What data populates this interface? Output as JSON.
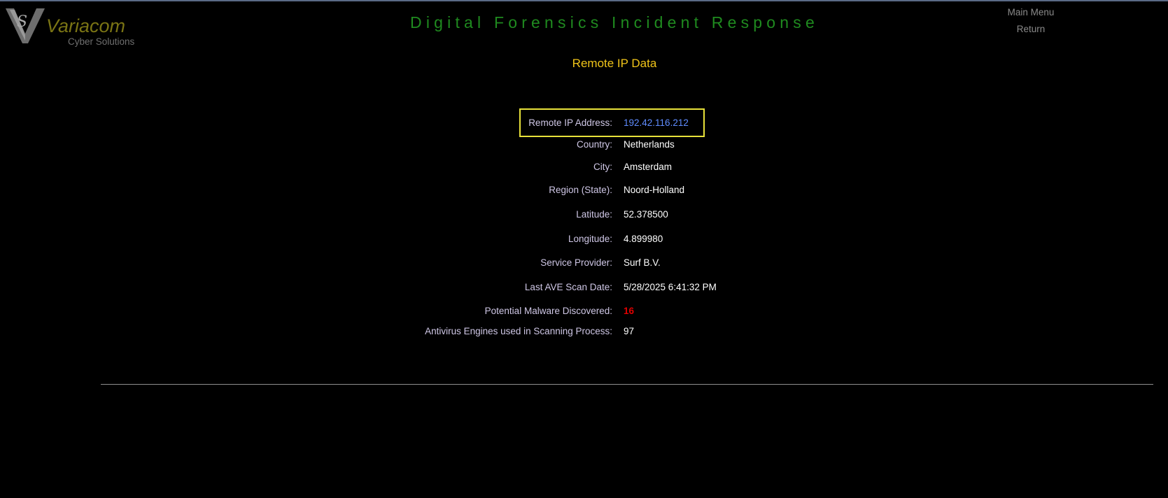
{
  "logo": {
    "name": "Variacom",
    "subtitle": "Cyber Solutions"
  },
  "header": {
    "title": "Digital Forensics Incident Response"
  },
  "nav": {
    "main_menu": "Main Menu",
    "return": "Return"
  },
  "section": {
    "title": "Remote IP Data"
  },
  "fields": {
    "remote_ip": {
      "label": "Remote IP Address:",
      "value": "192.42.116.212"
    },
    "country": {
      "label": "Country:",
      "value": "Netherlands"
    },
    "city": {
      "label": "City:",
      "value": "Amsterdam"
    },
    "region": {
      "label": "Region (State):",
      "value": "Noord-Holland"
    },
    "latitude": {
      "label": "Latitude:",
      "value": "52.378500"
    },
    "longitude": {
      "label": "Longitude:",
      "value": "4.899980"
    },
    "provider": {
      "label": "Service Provider:",
      "value": "Surf B.V."
    },
    "scan_date": {
      "label": "Last AVE Scan Date:",
      "value": "5/28/2025 6:41:32 PM"
    },
    "malware": {
      "label": "Potential Malware Discovered:",
      "value": "16"
    },
    "engines": {
      "label": "Antivirus Engines used in Scanning Process:",
      "value": "97"
    }
  },
  "colors": {
    "title_green": "#1f8a1f",
    "section_gold": "#f0c419",
    "ip_blue": "#5f8cff",
    "alert_red": "#e00000",
    "highlight_yellow": "#e8e23a",
    "label_lavender": "#cfc7e6"
  }
}
